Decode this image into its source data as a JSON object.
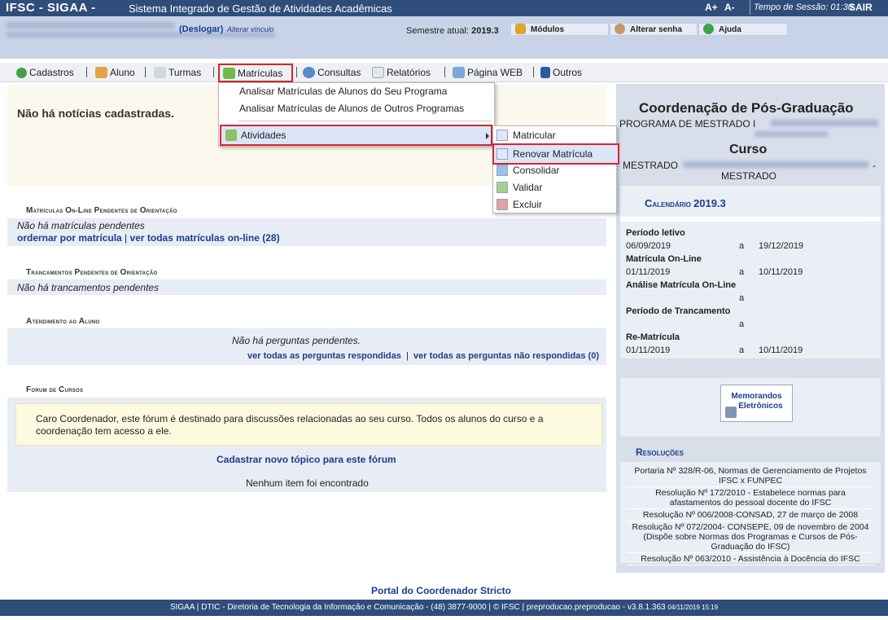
{
  "topbar": {
    "brand": "IFSC - SIGAA -",
    "subtitle": "Sistema Integrado de Gestão de Atividades Acadêmicas",
    "font_plus": "A+",
    "font_minus": "A-",
    "session_label": "Tempo de Sessão: 01:30",
    "logout": "SAIR",
    "bg": "#2e4d7a"
  },
  "user": {
    "deslogar": "(Deslogar)",
    "alterar_vinculo": "Alterar vínculo",
    "semester_label": "Semestre atual:",
    "semester_value": "2019.3"
  },
  "shortcuts": [
    {
      "label": "Módulos",
      "icon": "modules-icon"
    },
    {
      "label": "Alterar senha",
      "icon": "user-key-icon"
    },
    {
      "label": "Ajuda",
      "icon": "help-icon"
    }
  ],
  "menu": [
    {
      "label": "Cadastros",
      "icon": "plus-circle-icon"
    },
    {
      "label": "Aluno",
      "icon": "students-icon"
    },
    {
      "label": "Turmas",
      "icon": "classes-icon"
    },
    {
      "label": "Matrículas",
      "icon": "enroll-icon",
      "active": true
    },
    {
      "label": "Consultas",
      "icon": "search-icon"
    },
    {
      "label": "Relatórios",
      "icon": "report-icon"
    },
    {
      "label": "Página WEB",
      "icon": "web-icon"
    },
    {
      "label": "Outros",
      "icon": "phone-icon"
    }
  ],
  "dropdown": {
    "items": [
      "Analisar Matrículas de Alunos do Seu Programa",
      "Analisar Matrículas de Alunos de Outros Programas"
    ],
    "submenu_label": "Atividades"
  },
  "submenu": {
    "items": [
      "Matricular",
      "Renovar Matrícula",
      "Consolidar",
      "Validar",
      "Excluir"
    ]
  },
  "news": {
    "text": "Não há notícias cadastradas."
  },
  "matriculas": {
    "title_a": "M",
    "title_b": "atrículas ",
    "title_c": "O",
    "title_d": "n-",
    "title_e": "L",
    "title_f": "ine ",
    "title_g": "P",
    "title_h": "endentes de ",
    "title_i": "O",
    "title_j": "rientação",
    "empty": "Não há matrículas pendentes",
    "link1": "ordernar por matrícula",
    "divider": "|",
    "link2": "ver todas matrículas on-line (28)"
  },
  "trancamentos": {
    "title_a": "T",
    "title_b": "rancamentos ",
    "title_c": "P",
    "title_d": "endentes de ",
    "title_e": "O",
    "title_f": "rientação",
    "empty": "Não há trancamentos pendentes"
  },
  "atendimento": {
    "title_a": "A",
    "title_b": "tendimento ao ",
    "title_c": "A",
    "title_d": "luno",
    "empty": "Não há perguntas pendentes.",
    "link1": "ver todas as perguntas respondidas",
    "divider": "|",
    "link2": "ver todas as perguntas não respondidas (0)"
  },
  "forum": {
    "title_a": "F",
    "title_b": "orum de ",
    "title_c": "C",
    "title_d": "ursos",
    "notice": "Caro Coordenador, este fórum é destinado para discussões relacionadas ao seu curso. Todos os alunos do curso e a coordenação tem acesso a ele.",
    "new_topic": "Cadastrar novo tópico para este fórum",
    "empty": "Nenhum item foi encontrado"
  },
  "right": {
    "coord_title": "Coordenação de Pós-Graduação",
    "program_prefix": "PROGRAMA DE MESTRADO",
    "program_suffix": "I",
    "curso_label": "Curso",
    "curso_prefix": "MESTRADO",
    "curso_dash": "-",
    "curso_line2": "MESTRADO",
    "cal_a": "C",
    "cal_b": "alendário ",
    "cal_year": "2019.3",
    "calendar": [
      {
        "label": "Período letivo",
        "start": "06/09/2019",
        "end": "19/12/2019"
      },
      {
        "label": "Matrícula On-Line",
        "start": "01/11/2019",
        "end": "10/11/2019"
      },
      {
        "label": "Análise Matrícula On-Line",
        "start": "",
        "end": ""
      },
      {
        "label": "Período de Trancamento",
        "start": "",
        "end": ""
      },
      {
        "label": "Re-Matrícula",
        "start": "01/11/2019",
        "end": "10/11/2019"
      }
    ],
    "cal_sep": "a",
    "memo_line1": "Memorandos",
    "memo_line2": "Eletrônicos",
    "res_a": "R",
    "res_b": "esoluções",
    "resolucoes": [
      [
        "Portaria Nº 328/R-06, Normas de Gerenciamento de Projetos",
        "IFSC x FUNPEC"
      ],
      [
        "Resolução Nº 172/2010 - Estabelece normas para",
        "afastamentos do pessoal docente do IFSC"
      ],
      [
        "Resolução Nº 006/2008-CONSAD, 27 de março de 2008"
      ],
      [
        "Resolução Nº 072/2004- CONSEPE, 09 de novembro de 2004",
        "(Dispõe sobre Normas dos Programas e Cursos de Pós-",
        "Graduação do IFSC)"
      ],
      [
        "Resolução Nº 063/2010 - Assistência à Docência do IFSC"
      ]
    ]
  },
  "footer": {
    "portal": "Portal do Coordenador Stricto",
    "text": "SIGAA | DTIC - Diretoria de Tecnologia da Informação e Comunicação - (48) 3877-9000 | © IFSC | preproducao.preproducao - v3.8.1.363",
    "date": "04/11/2019 15:19"
  }
}
